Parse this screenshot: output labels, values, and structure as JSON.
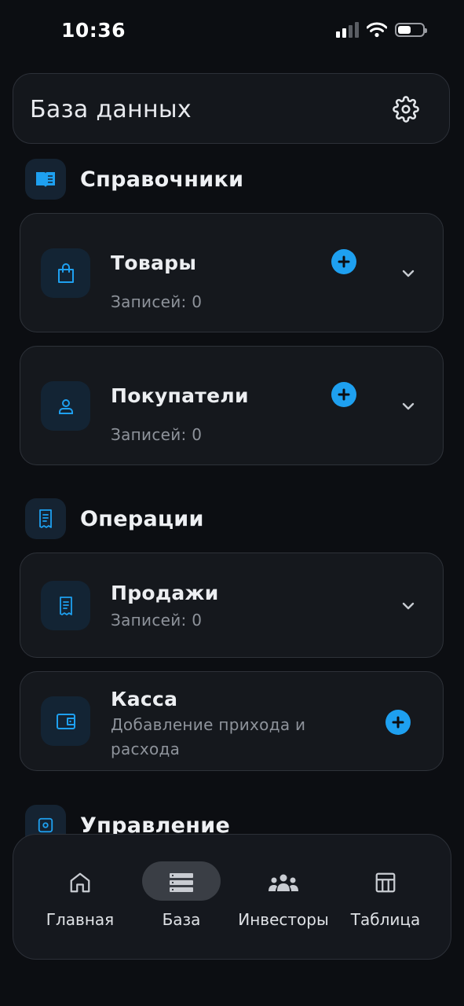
{
  "status": {
    "time": "10:36"
  },
  "header": {
    "title": "База данных"
  },
  "sections": {
    "directories": "Справочники",
    "operations": "Операции",
    "management": "Управление"
  },
  "cards": {
    "goods": {
      "title": "Товары",
      "sub": "Записей: 0"
    },
    "customers": {
      "title": "Покупатели",
      "sub": "Записей: 0"
    },
    "sales": {
      "title": "Продажи",
      "sub": "Записей: 0"
    },
    "cash": {
      "title": "Касса",
      "sub_line1": "Добавление прихода и",
      "sub_line2": "расхода"
    }
  },
  "nav": {
    "home": "Главная",
    "base": "База",
    "investors": "Инвесторы",
    "table": "Таблица"
  },
  "colors": {
    "accent": "#1ea0f0",
    "background": "#0c0e12",
    "card": "#15181d"
  },
  "icons": [
    "gear-icon",
    "book-icon",
    "shopping-bag-icon",
    "user-icon",
    "receipt-icon",
    "wallet-icon",
    "plus-icon",
    "chevron-down-icon",
    "home-icon",
    "database-icon",
    "users-icon",
    "table-icon"
  ]
}
